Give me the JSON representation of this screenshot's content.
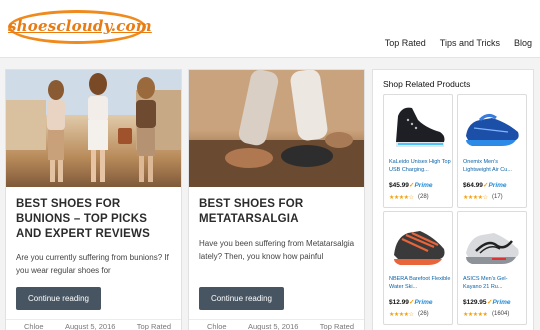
{
  "logo": {
    "text": "shoescloudy.com"
  },
  "nav": {
    "items": [
      "Top Rated",
      "Tips and Tricks",
      "Blog"
    ]
  },
  "posts": [
    {
      "title": "BEST SHOES FOR BUNIONS – TOP PICKS AND EXPERT REVIEWS",
      "excerpt": "Are you currently suffering from bunions? If you wear regular shoes for",
      "button": "Continue reading",
      "author": "Chloe",
      "date": "August 5, 2016",
      "category": "Top Rated"
    },
    {
      "title": "BEST SHOES FOR METATARSALGIA",
      "excerpt": "Have you been suffering from Metatarsalgia lately? Then, you know how painful",
      "button": "Continue reading",
      "author": "Chloe",
      "date": "August 5, 2016",
      "category": "Top Rated"
    }
  ],
  "sidebar": {
    "title": "Shop Related Products",
    "products": [
      {
        "name": "KaLeido Unisex High Top USB Charging...",
        "price": "$45.99",
        "prime": "Prime",
        "stars": "★★★★☆",
        "count": "(28)",
        "icon": "led-high-top-sneaker"
      },
      {
        "name": "Onemix Men's Lightweight Air Cu...",
        "price": "$64.99",
        "prime": "Prime",
        "stars": "★★★★☆",
        "count": "(17)",
        "icon": "blue-running-shoe"
      },
      {
        "name": "NBERA Barefoot Flexible Water Ski...",
        "price": "$12.99",
        "prime": "Prime",
        "stars": "★★★★☆",
        "count": "(26)",
        "icon": "water-shoe"
      },
      {
        "name": "ASICS Men's Gel-Kayano 21 Ru...",
        "price": "$129.95",
        "prime": "Prime",
        "stars": "★★★★★",
        "count": "(1604)",
        "icon": "asics-running-shoe"
      }
    ]
  },
  "colors": {
    "logo": "#e87b12",
    "button": "#475563",
    "link": "#0a63a8",
    "prime": "#1e8ad6",
    "stars": "#f3a20f"
  }
}
